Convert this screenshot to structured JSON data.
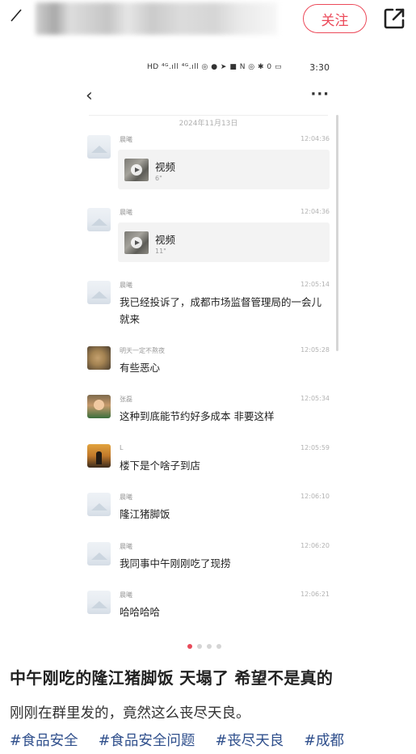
{
  "header": {
    "follow_label": "关注"
  },
  "chat": {
    "status_bar": {
      "icons": "HD ⁴ᴳ.ıll ⁴ᴳ.ıll ◎ ● ➤ ■   N ◎ ✱ 0 ▭",
      "time": "3:30"
    },
    "nav": {
      "back": "‹",
      "more": "···"
    },
    "date": "2024年11月13日",
    "messages": [
      {
        "sender": "晨曦",
        "time": "12:04:36",
        "video_title": "视频",
        "video_duration": "6\""
      },
      {
        "sender": "晨曦",
        "time": "12:04:36",
        "video_title": "视频",
        "video_duration": "11\""
      },
      {
        "sender": "晨曦",
        "time": "12:05:14",
        "text": "我已经投诉了，成都市场监督管理局的一会儿就来"
      },
      {
        "sender": "明天一定不熬夜",
        "time": "12:05:28",
        "text": "有些恶心"
      },
      {
        "sender": "张磊",
        "time": "12:05:34",
        "text": "这种到底能节约好多成本 非要这样"
      },
      {
        "sender": "L",
        "time": "12:05:59",
        "text": "楼下是个啥子到店"
      },
      {
        "sender": "晨曦",
        "time": "12:06:10",
        "text": "隆江猪脚饭"
      },
      {
        "sender": "晨曦",
        "time": "12:06:20",
        "text": "我同事中午刚刚吃了现捞"
      },
      {
        "sender": "晨曦",
        "time": "12:06:21",
        "text": "哈哈哈哈"
      }
    ]
  },
  "pager": {
    "count": 4,
    "active_index": 0
  },
  "post": {
    "title": "中午刚吃的隆江猪脚饭 天塌了 希望不是真的",
    "body": "刚刚在群里发的，竟然这么丧尽天良。",
    "tags": [
      "#食品安全",
      "#食品安全问题",
      "#丧尽天良",
      "#成都"
    ]
  },
  "colors": {
    "accent": "#ec4a5a",
    "tag": "#2f4f8c",
    "pager_active": "#e84a5a"
  }
}
